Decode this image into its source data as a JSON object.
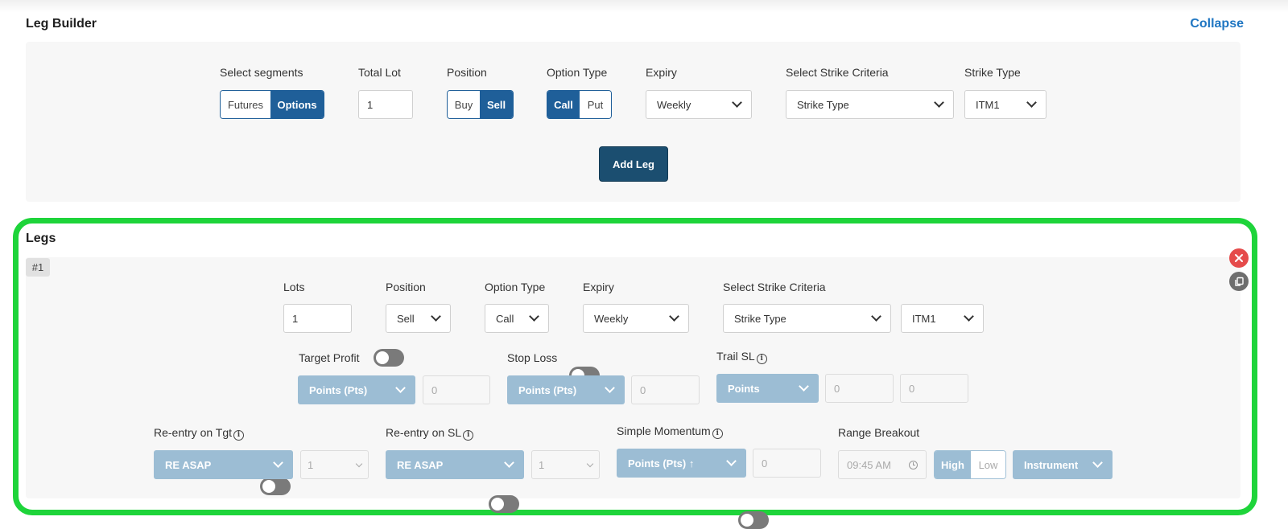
{
  "leg_builder": {
    "title": "Leg Builder",
    "collapse_label": "Collapse",
    "segments": {
      "label": "Select segments",
      "options": [
        "Futures",
        "Options"
      ],
      "selected": "Options"
    },
    "total_lot": {
      "label": "Total Lot",
      "value": "1"
    },
    "position": {
      "label": "Position",
      "options": [
        "Buy",
        "Sell"
      ],
      "selected": "Sell"
    },
    "option_type": {
      "label": "Option Type",
      "options": [
        "Call",
        "Put"
      ],
      "selected": "Call"
    },
    "expiry": {
      "label": "Expiry",
      "value": "Weekly"
    },
    "strike_criteria": {
      "label": "Select Strike Criteria",
      "value": "Strike Type"
    },
    "strike_type": {
      "label": "Strike Type",
      "value": "ITM1"
    },
    "add_leg_label": "Add Leg"
  },
  "legs": {
    "title": "Legs",
    "items": [
      {
        "index_label": "#1",
        "lots": {
          "label": "Lots",
          "value": "1"
        },
        "position": {
          "label": "Position",
          "value": "Sell"
        },
        "option_type": {
          "label": "Option Type",
          "value": "Call"
        },
        "expiry": {
          "label": "Expiry",
          "value": "Weekly"
        },
        "strike_criteria": {
          "label": "Select Strike Criteria",
          "value": "Strike Type"
        },
        "strike_value": "ITM1",
        "target_profit": {
          "label": "Target Profit",
          "enabled": false,
          "mode": "Points (Pts)",
          "value": "0"
        },
        "stop_loss": {
          "label": "Stop Loss",
          "enabled": false,
          "mode": "Points (Pts)",
          "value": "0"
        },
        "trail_sl": {
          "label": "Trail SL",
          "enabled": false,
          "mode": "Points",
          "value1": "0",
          "value2": "0"
        },
        "reentry_tgt": {
          "label": "Re-entry on Tgt",
          "enabled": false,
          "mode": "RE ASAP",
          "count": "1"
        },
        "reentry_sl": {
          "label": "Re-entry on SL",
          "enabled": false,
          "mode": "RE ASAP",
          "count": "1"
        },
        "simple_momentum": {
          "label": "Simple Momentum",
          "enabled": false,
          "mode": "Points (Pts) ↑",
          "value": "0"
        },
        "range_breakout": {
          "label": "Range Breakout",
          "enabled": false,
          "time": "09:45 AM",
          "options": [
            "High",
            "Low"
          ],
          "selected": "High",
          "instrument": "Instrument"
        }
      }
    ]
  },
  "info_glyph": "i",
  "colors": {
    "primary": "#1f5f99",
    "dark_button": "#1b4e70",
    "highlight_border": "#1ed43a",
    "delete": "#e54b4b",
    "copy": "#6e6e6e",
    "link": "#1f76c2"
  },
  "icons": [
    "chevron-down-icon",
    "info-icon",
    "close-icon",
    "copy-icon",
    "clock-icon"
  ]
}
